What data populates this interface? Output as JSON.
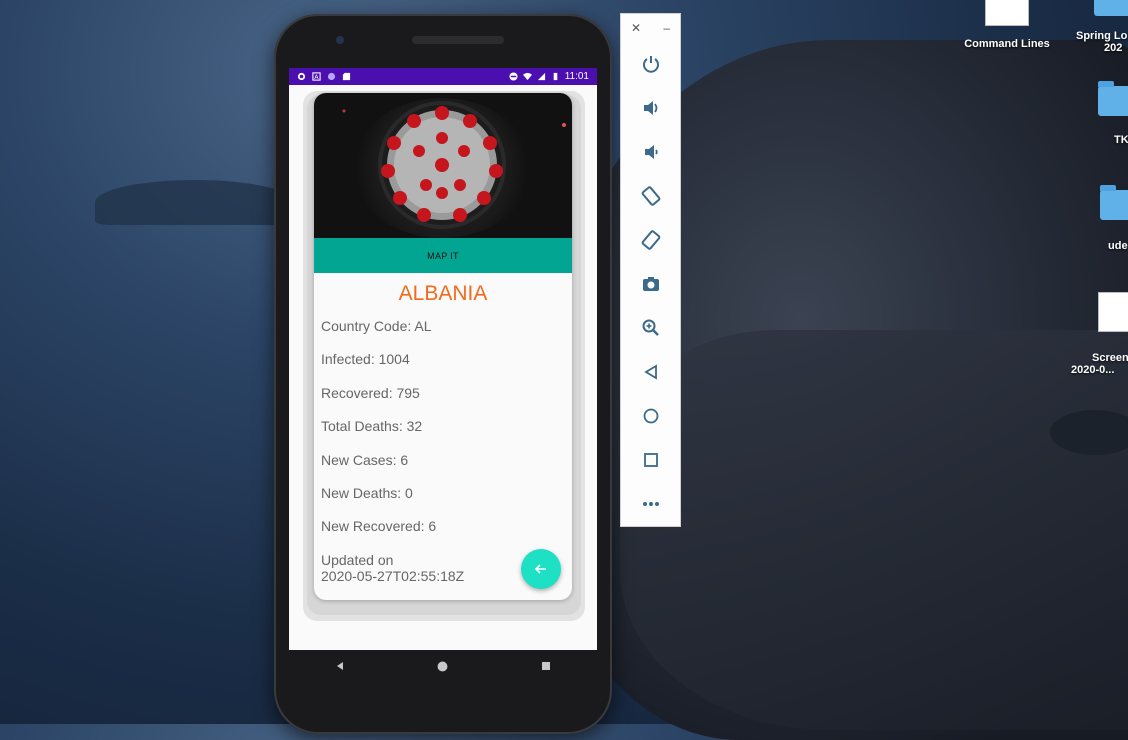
{
  "status_bar": {
    "time": "11:01"
  },
  "card": {
    "map_button": "MAP IT",
    "country": "ALBANIA",
    "stats": [
      "Country Code: AL",
      "Infected: 1004",
      "Recovered: 795",
      "Total Deaths: 32",
      "New Cases: 6",
      "New Deaths: 0",
      "New Recovered: 6"
    ],
    "updated_label": "Updated on",
    "updated_value": "2020-05-27T02:55:18Z"
  },
  "emulator_toolbar": {
    "buttons": [
      "power-icon",
      "volume-up-icon",
      "volume-down-icon",
      "rotate-left-icon",
      "rotate-right-icon",
      "camera-icon",
      "zoom-icon",
      "back-icon",
      "home-icon",
      "overview-icon",
      "more-icon"
    ]
  },
  "desktop": {
    "icons": [
      {
        "label": "Command Lines",
        "type": "document"
      },
      {
        "label": "Spring Lo",
        "sublabel": "202",
        "type": "folder"
      },
      {
        "label": "TK",
        "type": "folder"
      },
      {
        "label": "ude",
        "type": "folder"
      },
      {
        "label": "Screen",
        "sublabel": "2020-0...",
        "type": "document"
      }
    ]
  },
  "colors": {
    "status_bar": "#4b0fb0",
    "map_button": "#01a591",
    "country_title": "#f26b1d",
    "fab": "#1de0c4"
  }
}
